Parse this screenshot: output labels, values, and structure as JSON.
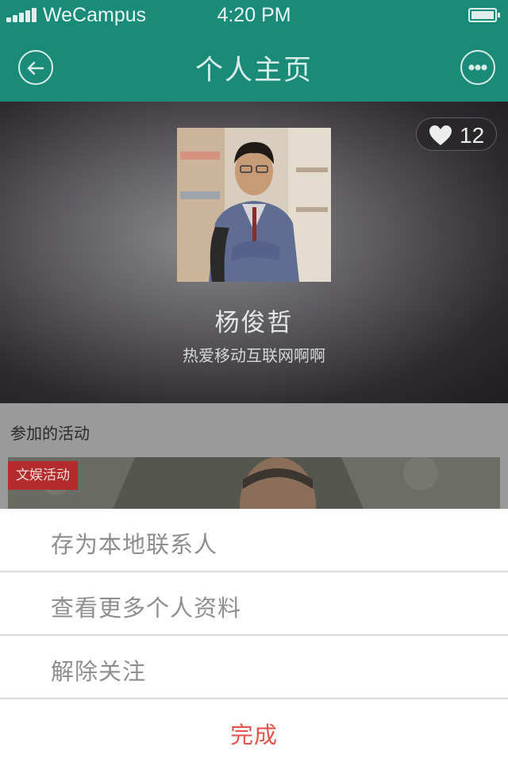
{
  "status_bar": {
    "carrier": "WeCampus",
    "time": "4:20 PM",
    "icons": [
      "signal-icon",
      "battery-icon"
    ]
  },
  "nav": {
    "title": "个人主页",
    "back_icon": "back-arrow-icon",
    "more_icon": "more-options-icon"
  },
  "profile": {
    "name": "杨俊哲",
    "bio": "热爱移动互联网啊啊",
    "likes": "12",
    "like_icon": "heart-icon"
  },
  "activities": {
    "section_title": "参加的活动",
    "items": [
      {
        "tag": "文娱活动"
      }
    ]
  },
  "action_sheet": {
    "items": [
      {
        "label": "存为本地联系人"
      },
      {
        "label": "查看更多个人资料"
      },
      {
        "label": "解除关注"
      }
    ],
    "done_label": "完成"
  },
  "colors": {
    "brand": "#1a8b79",
    "tag": "#b32b2c",
    "done": "#e4534c"
  }
}
